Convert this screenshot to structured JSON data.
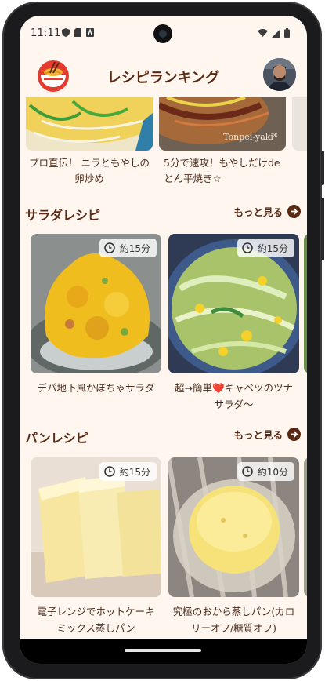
{
  "status": {
    "time": "11:11"
  },
  "header": {
    "title": "レシピランキング"
  },
  "top_row": [
    {
      "caption": "プロ直伝！ ニラともやしの卵炒め"
    },
    {
      "caption": "5分で速攻！もやしだけdeとん平焼き☆",
      "watermark": "Tonpei-yaki*"
    },
    {
      "caption": ""
    }
  ],
  "sections": [
    {
      "title": "サラダレシピ",
      "more_label": "もっと見る",
      "cards": [
        {
          "time": "約15分",
          "caption": "デパ地下風かぼちゃサラダ"
        },
        {
          "time": "約15分",
          "caption": "超→簡単❤️キャベツのツナサラダ〜"
        }
      ]
    },
    {
      "title": "パンレシピ",
      "more_label": "もっと見る",
      "cards": [
        {
          "time": "約15分",
          "caption": "電子レンジでホットケーキミックス蒸しパン"
        },
        {
          "time": "約10分",
          "caption": "究極のおから蒸しパン(カロリーオフ/糖質オフ)"
        }
      ]
    }
  ],
  "icons": {
    "clock": "clock-icon",
    "arrow": "arrow-right-icon",
    "logo": "bowl-logo-icon"
  },
  "colors": {
    "accent": "#5a2a14",
    "background": "#fff7ef"
  }
}
